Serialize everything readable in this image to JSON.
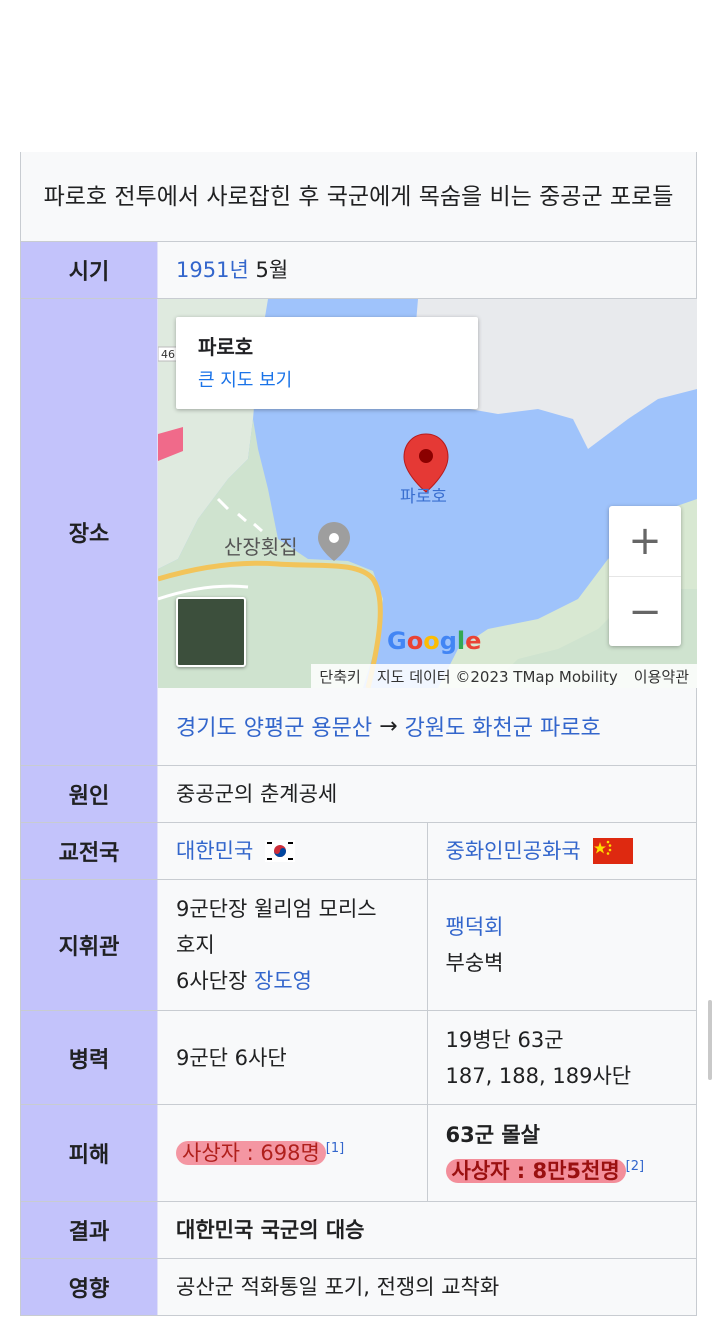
{
  "infobox": {
    "caption": "파로호 전투에서 사로잡힌 후 국군에게 목숨을 비는 중공군 포로들",
    "date": {
      "label": "시기",
      "year_link": "1951년",
      "month": "5월"
    },
    "location": {
      "label": "장소",
      "map": {
        "popup_title": "파로호",
        "popup_link": "큰 지도 보기",
        "marker_label": "파로호",
        "place_label": "산장횟집",
        "road_badge": "46",
        "zoom_in": "+",
        "zoom_out": "−",
        "google_logo": "Google",
        "attribution": [
          "단축키",
          "지도 데이터 ©2023 TMap Mobility",
          "이용약관"
        ]
      },
      "from": "경기도 양평군 용문산",
      "arrow": "→",
      "to": "강원도 화천군 파로호"
    },
    "cause": {
      "label": "원인",
      "value": "중공군의 춘계공세"
    },
    "belligerents": {
      "label": "교전국",
      "left": "대한민국",
      "right": "중화인민공화국"
    },
    "commanders": {
      "label": "지휘관",
      "left_line1": "9군단장 윌리엄 모리스",
      "left_line2": "호지",
      "left_line3_prefix": "6사단장",
      "left_line3_link": "장도영",
      "right_line1": "팽덕회",
      "right_line2": "부숭벽"
    },
    "strength": {
      "label": "병력",
      "left": "9군단 6사단",
      "right_line1": "19병단 63군",
      "right_line2": "187, 188, 189사단"
    },
    "casualties": {
      "label": "피해",
      "left": "사상자 : 698명",
      "left_ref": "[1]",
      "right_line1": "63군 몰살",
      "right_line2": "사상자 : 8만5천명",
      "right_ref": "[2]"
    },
    "result": {
      "label": "결과",
      "value": "대한민국 국군의 대승"
    },
    "effect": {
      "label": "영향",
      "value": "공산군 적화통일 포기, 전쟁의 교착화"
    }
  },
  "colors": {
    "header_bg": "#c3c3fb",
    "link": "#3366cc",
    "highlight": "#f0465a"
  }
}
